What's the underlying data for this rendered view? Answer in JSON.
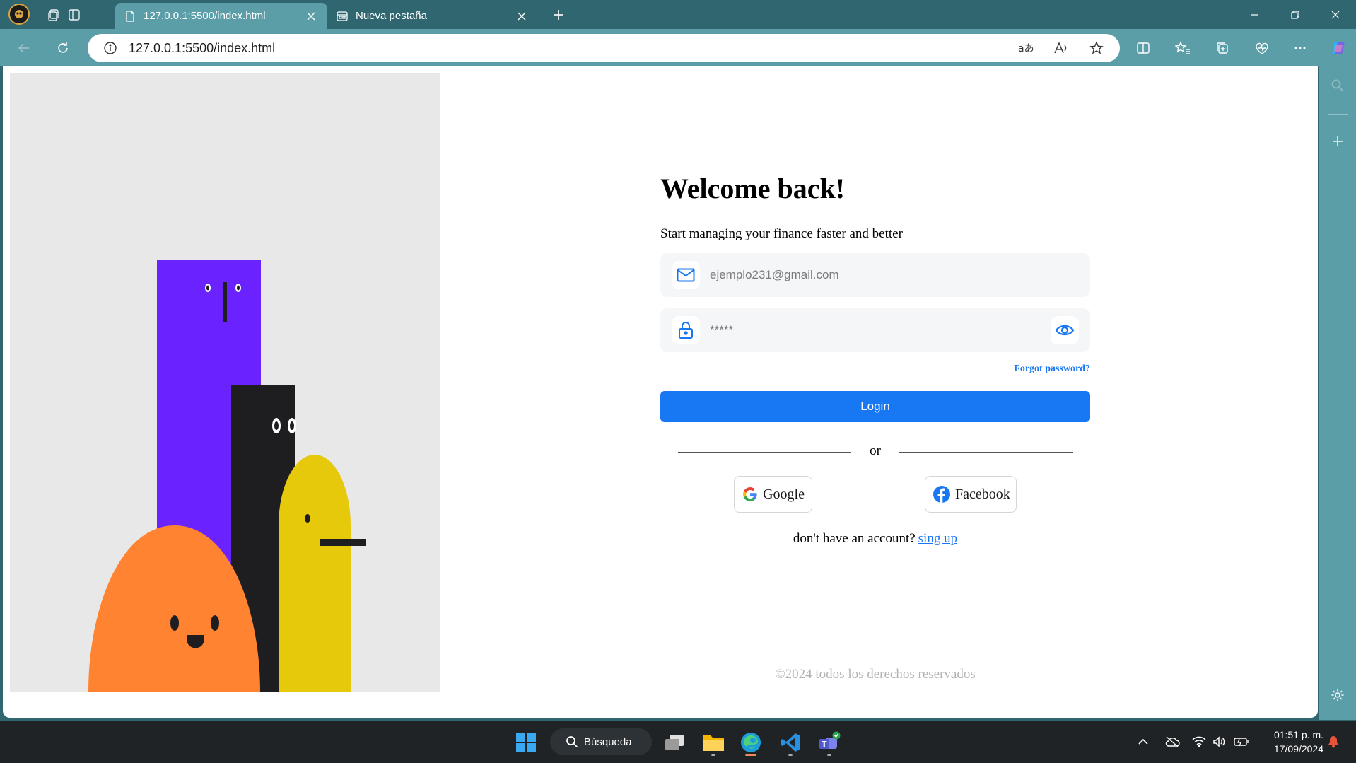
{
  "browser": {
    "tabs": [
      {
        "title": "127.0.0.1:5500/index.html",
        "active": true
      },
      {
        "title": "Nueva pestaña",
        "active": false
      }
    ],
    "address": {
      "url": "127.0.0.1:5500/index.html"
    }
  },
  "page": {
    "heading": "Welcome back!",
    "subheading": "Start managing your finance faster and better",
    "email_placeholder": "ejemplo231@gmail.com",
    "password_value": "*****",
    "forgot_password": "Forgot password?",
    "login_label": "Login",
    "or_label": "or",
    "google_label": "Google",
    "facebook_label": "Facebook",
    "signup_prompt": "don't have an account?",
    "signup_link": "sing up",
    "footer": "©2024 todos los derechos reservados",
    "colors": {
      "accent": "#1877f2",
      "purple": "#6a22ff",
      "black": "#1e1e21",
      "orange": "#ff8331",
      "yellow": "#e6c90a"
    }
  },
  "taskbar": {
    "search_label": "Búsqueda",
    "time": "01:51 p. m.",
    "date": "17/09/2024"
  }
}
